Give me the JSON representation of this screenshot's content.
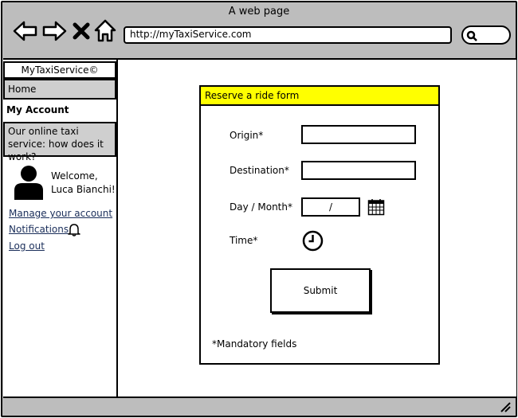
{
  "window": {
    "title": "A web page",
    "url": "http://myTaxiService.com"
  },
  "sidebar": {
    "brand": "MyTaxiService©",
    "home": "Home",
    "my_account": "My Account",
    "how_it_works": "Our online taxi service: how does it work?",
    "welcome_line1": "Welcome,",
    "welcome_line2": "Luca Bianchi!",
    "manage_account": "Manage your account",
    "notifications": "Notifications",
    "logout": "Log out"
  },
  "form": {
    "header": "Reserve a ride form",
    "origin_label": "Origin*",
    "origin_value": "",
    "destination_label": "Destination*",
    "destination_value": "",
    "day_month_label": "Day / Month*",
    "day_month_value": "/",
    "time_label": "Time*",
    "submit_label": "Submit",
    "mandatory_note": "*Mandatory fields"
  },
  "colors": {
    "chrome": "#bdbdbd",
    "form_header": "#ffff00",
    "link": "#1a2e5a"
  },
  "icons": [
    "back-arrow-icon",
    "forward-arrow-icon",
    "close-icon",
    "home-icon",
    "search-icon",
    "user-avatar-icon",
    "bell-icon",
    "calendar-icon",
    "clock-icon",
    "resize-grip-icon"
  ]
}
